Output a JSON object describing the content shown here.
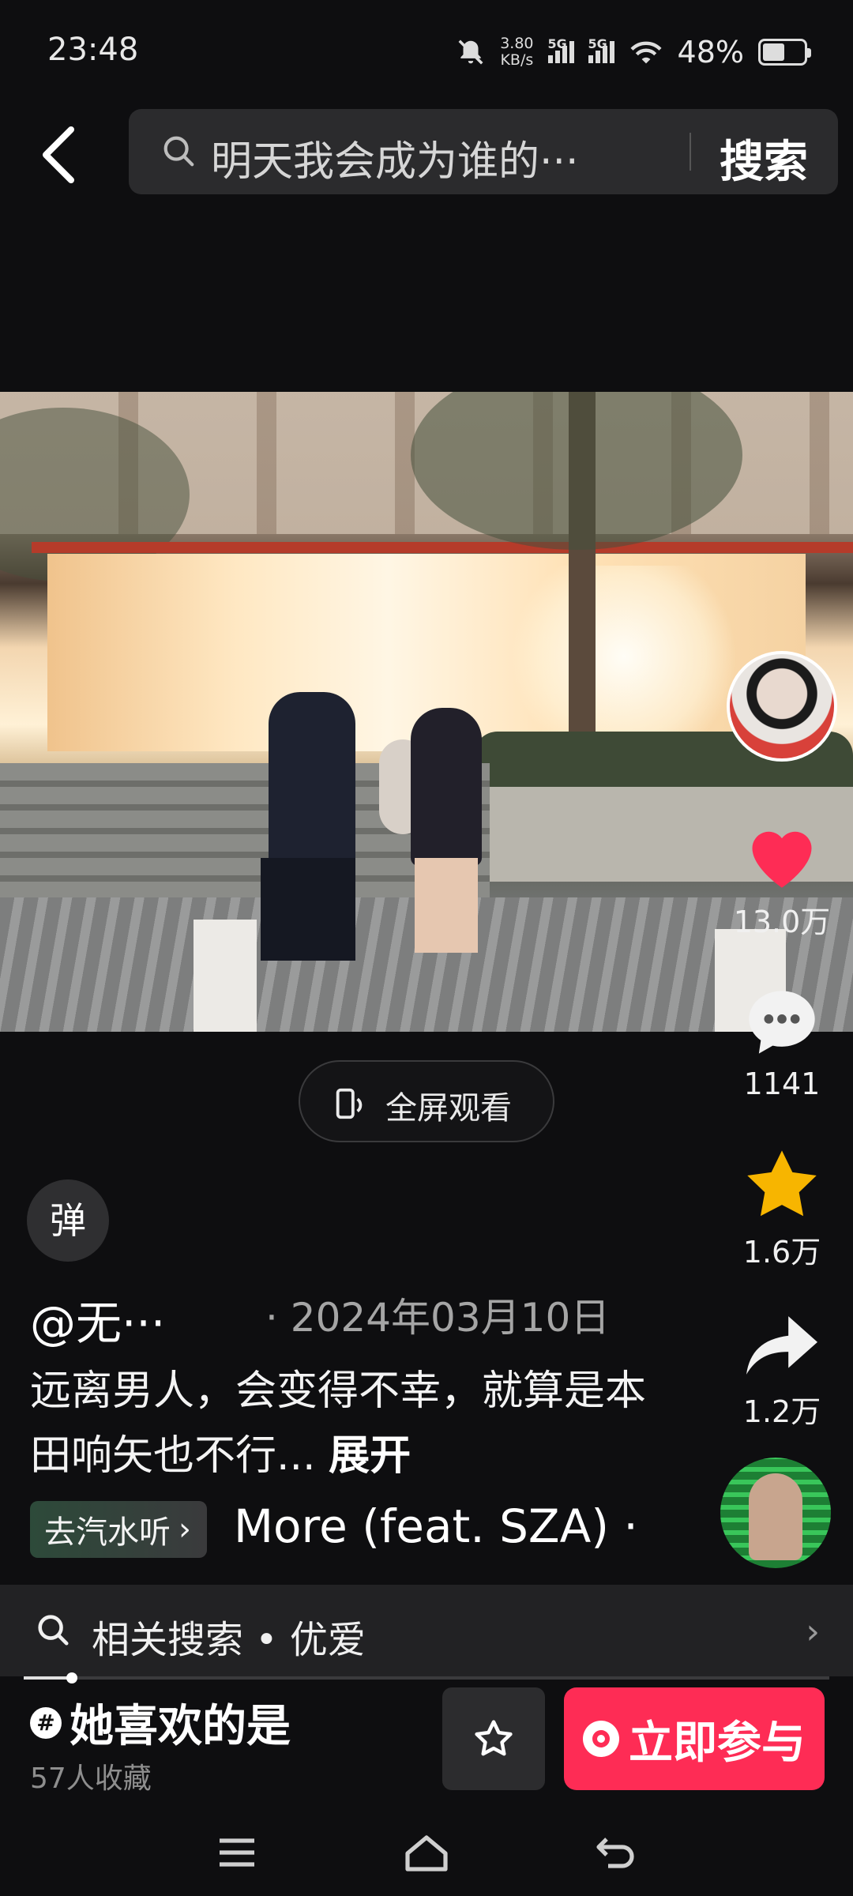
{
  "status_bar": {
    "time": "23:48",
    "net_speed_value": "3.80",
    "net_speed_unit": "KB/s",
    "sim1": "5G",
    "sim2": "5G",
    "battery": "48%"
  },
  "header": {
    "search_query": "明天我会成为谁的···",
    "search_button": "搜索"
  },
  "video": {
    "fullscreen_label": "全屏观看"
  },
  "actions": {
    "likes": "13.0万",
    "comments": "1141",
    "favorites": "1.6万",
    "shares": "1.2万"
  },
  "danmaku_label": "弹",
  "post": {
    "author": "@无···",
    "date": "2024年03月10日",
    "description": "远离男人，会变得不幸，就算是本田响矢也不行...",
    "expand": "展开"
  },
  "music": {
    "listen_label": "去汽水听",
    "song": "More (feat. SZA) ·"
  },
  "related_search": {
    "label": "相关搜索 • 优爱"
  },
  "progress": {
    "fraction": 0.06
  },
  "challenge": {
    "title": "她喜欢的是",
    "subtitle": "57人收藏",
    "join_label": "立即参与"
  },
  "colors": {
    "like": "#fe2c55",
    "favorite": "#f7b500",
    "join": "#fe2c55"
  }
}
